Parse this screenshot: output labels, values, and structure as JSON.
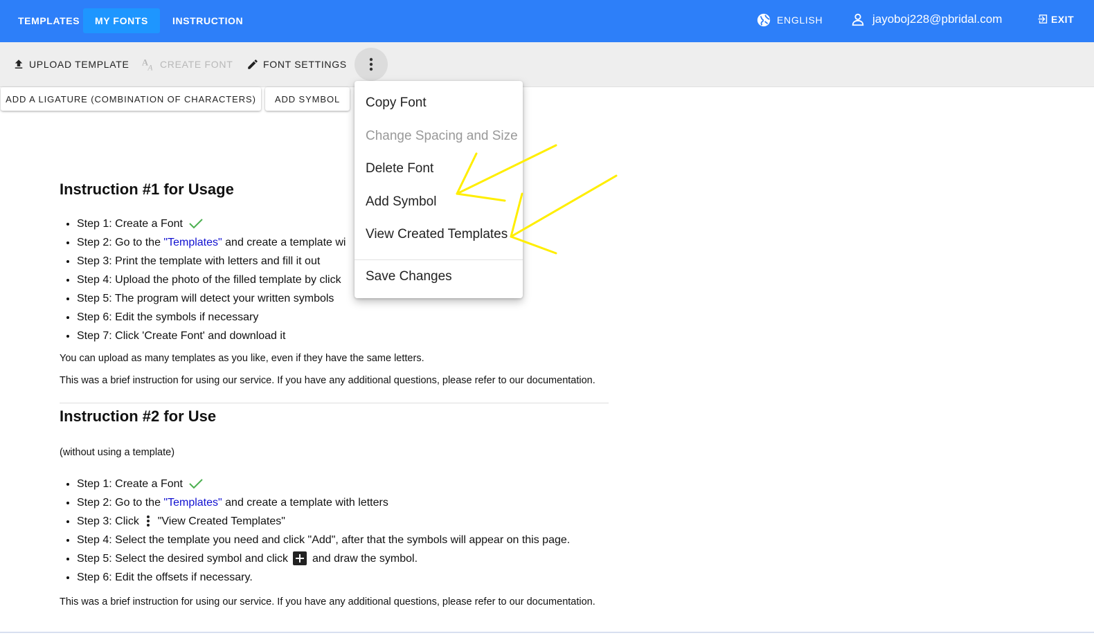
{
  "header": {
    "tabs": [
      {
        "label": "TEMPLATES",
        "active": false
      },
      {
        "label": "MY FONTS",
        "active": true
      },
      {
        "label": "INSTRUCTION",
        "active": false
      }
    ],
    "language": "ENGLISH",
    "user_email": "jayoboj228@pbridal.com",
    "exit_label": "EXIT"
  },
  "toolbar": {
    "upload_template": "UPLOAD TEMPLATE",
    "create_font": "CREATE FONT",
    "font_settings": "FONT SETTINGS"
  },
  "secondary": {
    "add_ligature": "ADD A LIGATURE (COMBINATION OF CHARACTERS)",
    "add_symbol": "ADD SYMBOL"
  },
  "menu": {
    "items": [
      {
        "label": "Copy Font",
        "enabled": true
      },
      {
        "label": "Change Spacing and Size",
        "enabled": false
      },
      {
        "label": "Delete Font",
        "enabled": true
      },
      {
        "label": "Add Symbol",
        "enabled": true
      },
      {
        "label": "View Created Templates",
        "enabled": true
      }
    ],
    "save_changes": "Save Changes"
  },
  "instruction1": {
    "title": "Instruction #1 for Usage",
    "steps": {
      "s1": "Step 1: Create a Font",
      "s2_pre": "Step 2: Go to the ",
      "s2_link": "\"Templates\"",
      "s2_post": " and create a template wi",
      "s3": "Step 3: Print the template with letters and fill it out",
      "s4": "Step 4: Upload the photo of the filled template by click",
      "s5": "Step 5: The program will detect your written symbols",
      "s6": "Step 6: Edit the symbols if necessary",
      "s7": "Step 7: Click 'Create Font' and download it"
    },
    "note1": "You can upload as many templates as you like, even if they have the same letters.",
    "note2": "This was a brief instruction for using our service. If you have any additional questions, please refer to our documentation."
  },
  "instruction2": {
    "title": "Instruction #2 for Use",
    "subtitle": "(without using a template)",
    "steps": {
      "s1": "Step 1: Create a Font",
      "s2_pre": "Step 2: Go to the ",
      "s2_link": "\"Templates\"",
      "s2_post": " and create a template with letters",
      "s3_pre": "Step 3: Click ",
      "s3_post": " \"View Created Templates\"",
      "s4": "Step 4: Select the template you need and click \"Add\", after that the symbols will appear on this page.",
      "s5_pre": "Step 5: Select the desired symbol and click ",
      "s5_post": " and draw the symbol.",
      "s6": "Step 6: Edit the offsets if necessary."
    },
    "note": "This was a brief instruction for using our service. If you have any additional questions, please refer to our documentation."
  },
  "colors": {
    "appbar": "#2d7ff9",
    "active_tab": "#1e96ff",
    "link": "#1010d0",
    "check": "#4caf50",
    "annotation_arrow": "#ffee00"
  }
}
